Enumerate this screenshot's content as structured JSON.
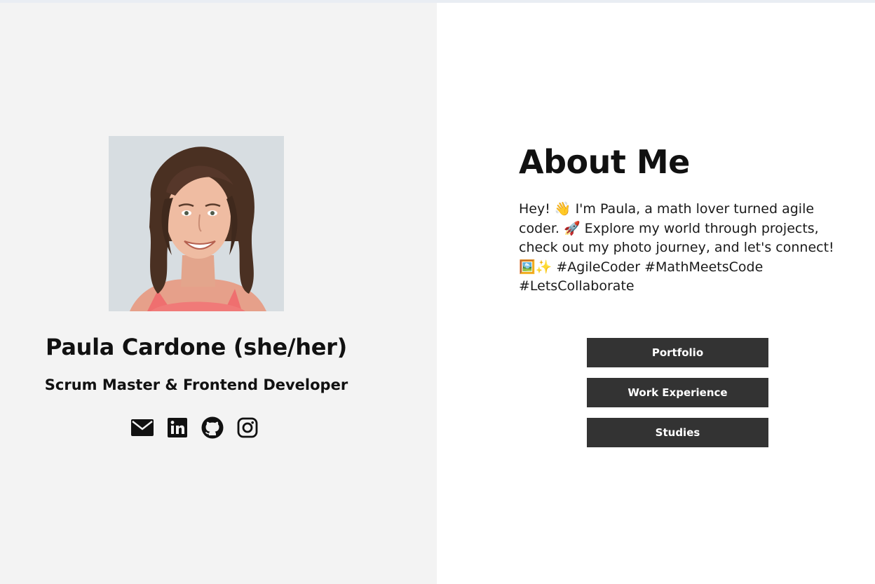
{
  "profile": {
    "name": "Paula Cardone (she/her)",
    "role": "Scrum Master & Frontend Developer",
    "photo_alt": "Paula Cardone"
  },
  "socials": [
    {
      "icon": "envelope-icon"
    },
    {
      "icon": "linkedin-icon"
    },
    {
      "icon": "github-icon"
    },
    {
      "icon": "instagram-icon"
    }
  ],
  "about": {
    "title": "About Me",
    "text": "Hey! 👋 I'm Paula, a math lover turned agile coder. 🚀 Explore my world through projects, check out my photo journey, and let's connect! 🖼️✨ #AgileCoder #MathMeetsCode #LetsCollaborate"
  },
  "buttons": {
    "portfolio": "Portfolio",
    "work_experience": "Work Experience",
    "studies": "Studies"
  },
  "colors": {
    "left_panel_bg": "#f3f3f3",
    "right_panel_bg": "#ffffff",
    "button_bg": "#333333",
    "button_text": "#ffffff",
    "text": "#111111"
  }
}
